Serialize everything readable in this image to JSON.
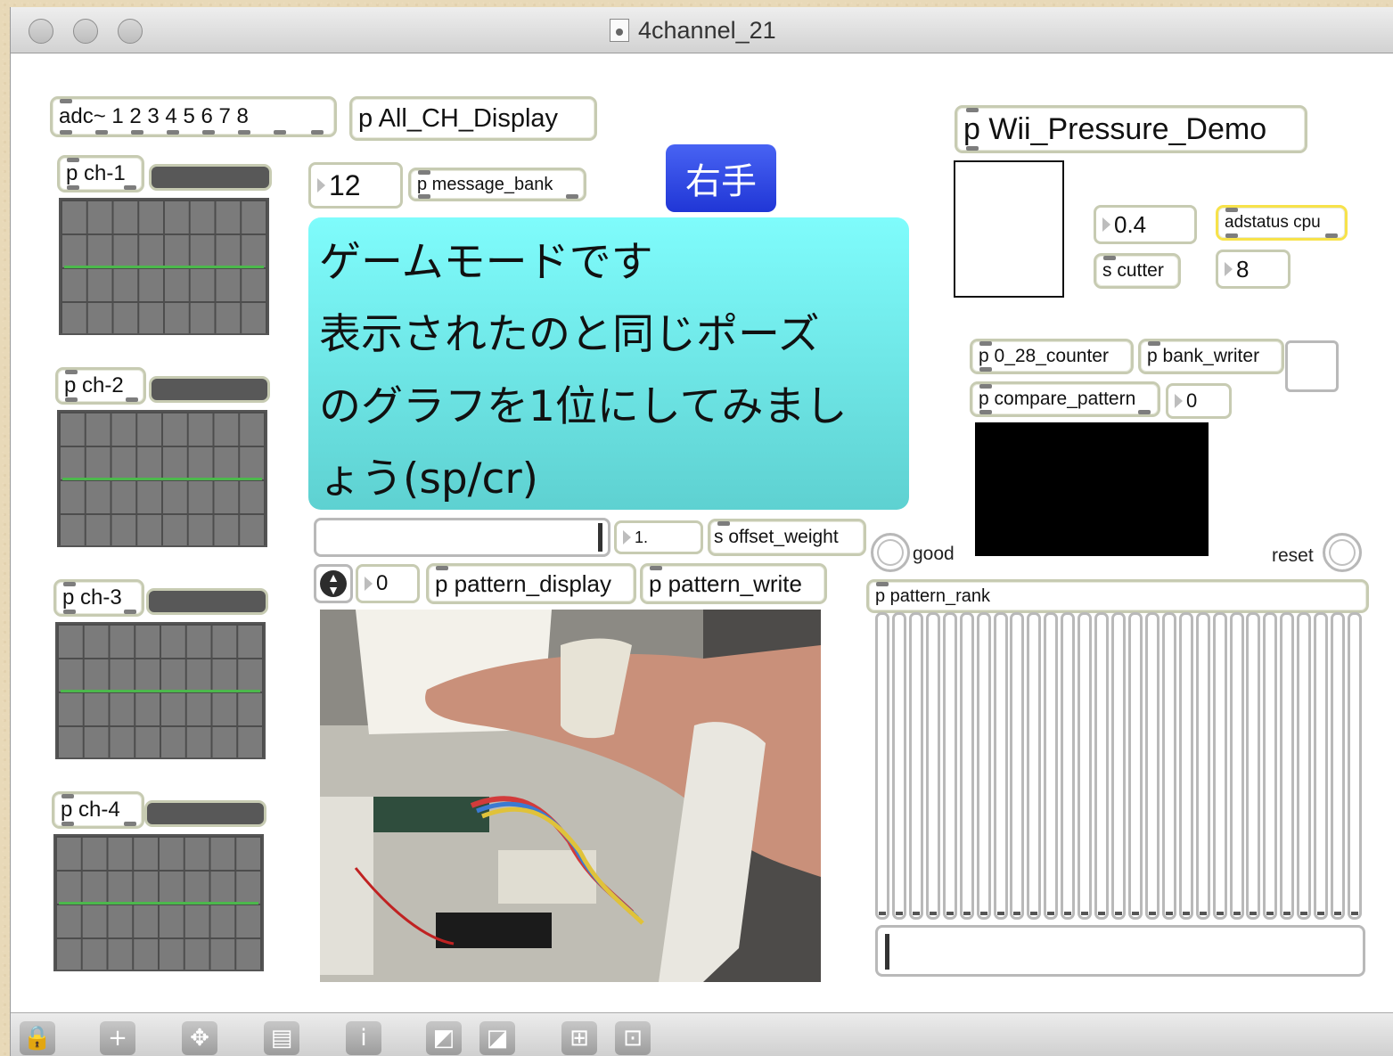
{
  "window": {
    "title": "4channel_21"
  },
  "objects": {
    "adc": "adc~ 1 2 3 4 5 6 7 8",
    "all_ch_display": "p All_CH_Display",
    "wii_demo": "p Wii_Pressure_Demo",
    "ch1": "p ch-1",
    "ch2": "p ch-2",
    "ch3": "p ch-3",
    "ch4": "p ch-4",
    "message_bank": "p message_bank",
    "counter": "p 0_28_counter",
    "bank_writer": "p bank_writer",
    "compare_pattern": "p compare_pattern",
    "s_offset_weight": "s offset_weight",
    "pattern_display": "p pattern_display",
    "pattern_write": "p pattern_write",
    "pattern_rank": "p pattern_rank",
    "s_cutter": "s cutter",
    "adstatus": "adstatus cpu"
  },
  "numbers": {
    "bank_num": "12",
    "cutter_val": "0.4",
    "cpu_val": "8",
    "compare_val": "0",
    "offset_val": "1.",
    "pattern_num": "0"
  },
  "hand_label": "右手",
  "message_lines": [
    "ゲームモードです",
    "表示されたのと同じポーズ",
    "のグラフを1位にしてみまし",
    "ょう(sp/cr)"
  ],
  "labels": {
    "good": "good",
    "reset": "reset"
  },
  "slider_count": 29,
  "icons": [
    "lock-icon",
    "plus-icon",
    "move-icon",
    "presentation-icon",
    "info-icon",
    "bring-front-icon",
    "send-back-icon",
    "grid-icon",
    "snap-grid-icon"
  ],
  "colors": {
    "object_border": "#c7cbb2",
    "message_cyan": "#7ffbfb",
    "hand_blue": "#2d49e8",
    "adstatus_border": "#f7e24a",
    "trace_green": "#4cb84c"
  }
}
